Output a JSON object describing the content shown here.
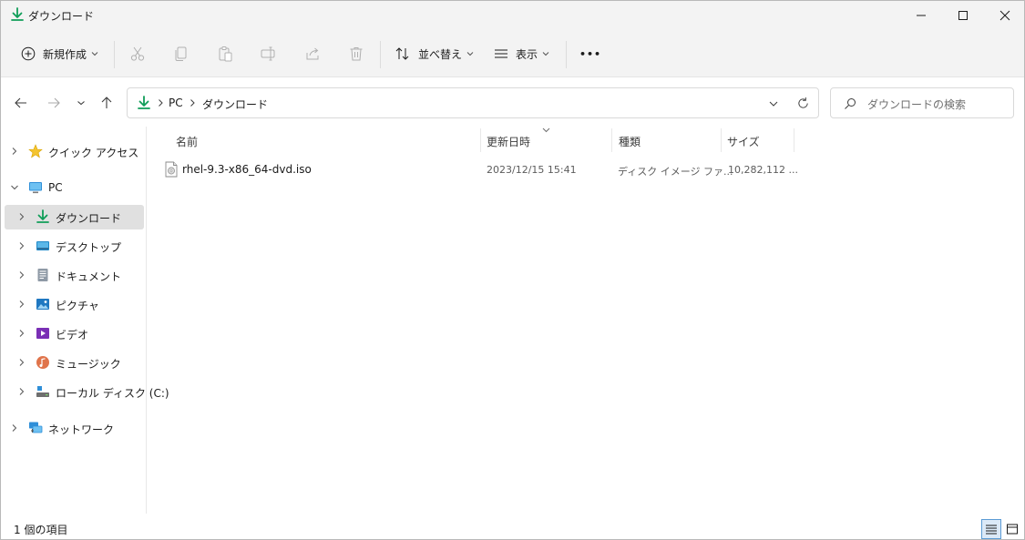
{
  "window": {
    "title": "ダウンロード"
  },
  "toolbar": {
    "new_label": "新規作成",
    "sort_label": "並べ替え",
    "view_label": "表示",
    "more_label": "•••",
    "icons": [
      "cut-icon",
      "copy-icon",
      "paste-icon",
      "rename-icon",
      "share-icon",
      "delete-icon"
    ]
  },
  "address": {
    "crumbs": [
      "PC",
      "ダウンロード"
    ],
    "search_placeholder": "ダウンロードの検索"
  },
  "nav": {
    "quick_access": "クイック アクセス",
    "pc": "PC",
    "downloads": "ダウンロード",
    "desktop": "デスクトップ",
    "documents": "ドキュメント",
    "pictures": "ピクチャ",
    "videos": "ビデオ",
    "music": "ミュージック",
    "local_disk": "ローカル ディスク (C:)",
    "network": "ネットワーク"
  },
  "columns": {
    "name": "名前",
    "date": "更新日時",
    "type": "種類",
    "size": "サイズ"
  },
  "files": [
    {
      "name": "rhel-9.3-x86_64-dvd.iso",
      "date": "2023/12/15 15:41",
      "type": "ディスク イメージ ファ...",
      "size": "10,282,112 ..."
    }
  ],
  "status": {
    "count": "1 個の項目"
  },
  "colors": {
    "accent": "#0f9d58",
    "selected": "#e0e0e0",
    "view_active": "#dbe9f7"
  }
}
